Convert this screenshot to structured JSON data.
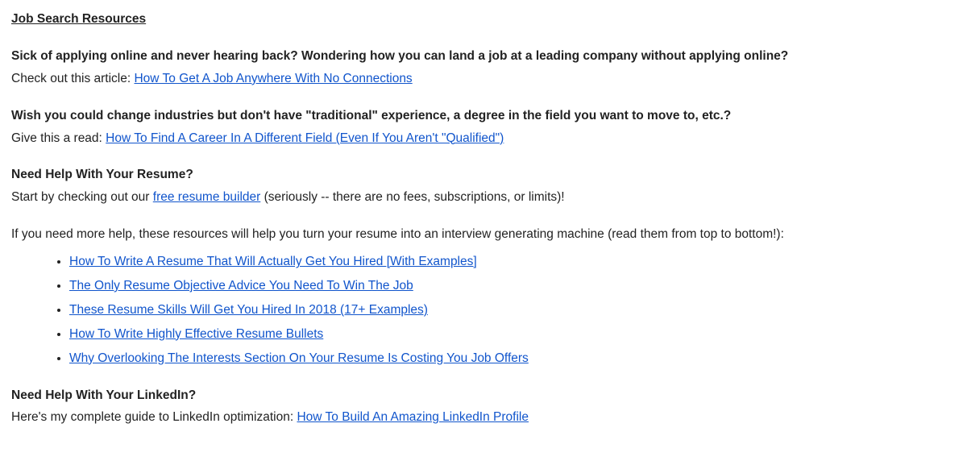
{
  "title": "Job Search Resources",
  "sections": [
    {
      "bold": "Sick of applying online and never hearing back? Wondering how you can land a job at a leading company without applying online?",
      "prefix": "Check out this article: ",
      "link": "How To Get A Job Anywhere With No Connections",
      "suffix": ""
    },
    {
      "bold": "Wish you could change industries but don't have \"traditional\" experience, a degree in the field you want to move to, etc.?",
      "prefix": "Give this a read: ",
      "link": "How To Find A Career In A Different Field (Even If You Aren't \"Qualified\")",
      "suffix": ""
    },
    {
      "bold": "Need Help With Your Resume?",
      "prefix": "Start by checking out our ",
      "link": "free resume builder",
      "suffix": " (seriously -- there are no fees, subscriptions, or limits)!"
    }
  ],
  "resume_intro": "If you need more help, these resources will help you turn your resume into an interview generating machine (read them from top to bottom!):",
  "resume_links": [
    "How To Write A Resume That Will Actually Get You Hired [With Examples]",
    "The Only Resume Objective Advice You Need To Win The Job",
    "These Resume Skills Will Get You Hired In 2018 (17+ Examples)",
    "How To Write Highly Effective Resume Bullets",
    "Why Overlooking The Interests Section On Your Resume Is Costing You Job Offers"
  ],
  "linkedin": {
    "bold": "Need Help With Your LinkedIn?",
    "prefix": "Here's my complete guide to LinkedIn optimization: ",
    "link": "How To Build An Amazing LinkedIn Profile"
  }
}
